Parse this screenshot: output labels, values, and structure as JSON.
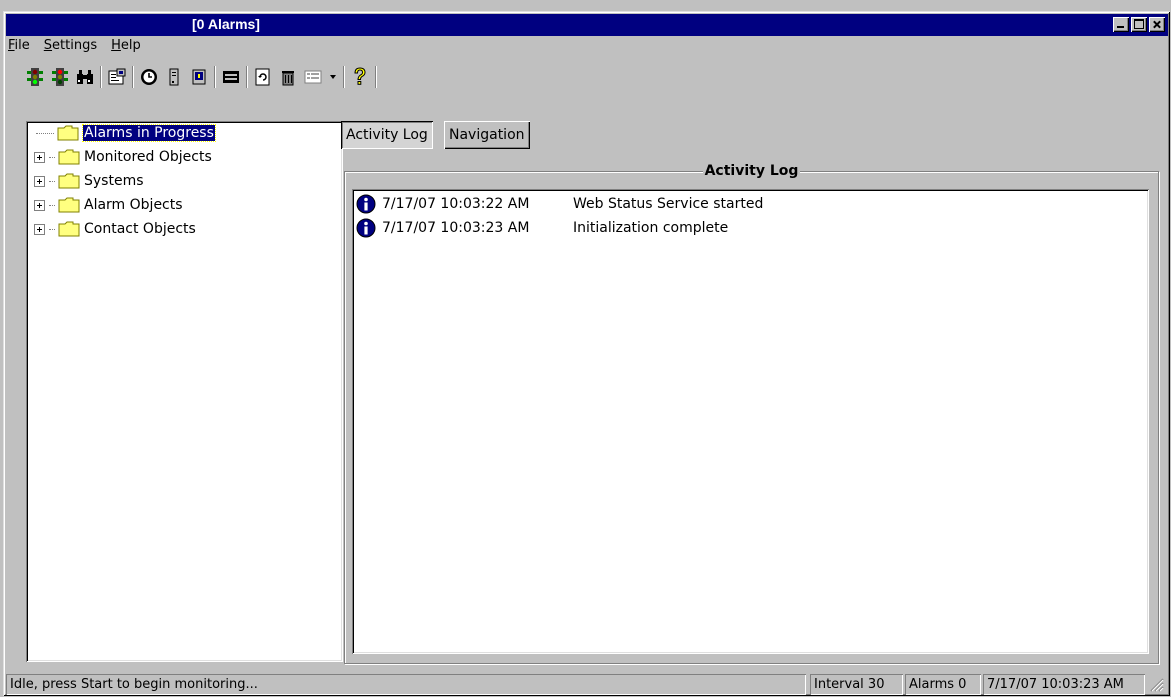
{
  "window": {
    "title": "[0 Alarms]"
  },
  "menu": [
    {
      "label": "File",
      "mnemonic": "F",
      "rest": "ile"
    },
    {
      "label": "Settings",
      "mnemonic": "S",
      "rest": "ettings"
    },
    {
      "label": "Help",
      "mnemonic": "H",
      "rest": "elp"
    }
  ],
  "toolbar": {
    "icons": [
      "traffic-light-start-icon",
      "traffic-light-stop-icon",
      "binoculars-icon",
      "properties-icon",
      "clock-icon",
      "server-icon",
      "monitor-icon",
      "display-icon",
      "refresh-icon",
      "trash-icon",
      "view-icon",
      "dropdown-arrow-icon",
      "help-icon"
    ]
  },
  "tree": {
    "items": [
      {
        "label": "Alarms in Progress",
        "selected": true
      },
      {
        "label": "Monitored Objects"
      },
      {
        "label": "Systems"
      },
      {
        "label": "Alarm Objects"
      },
      {
        "label": "Contact Objects"
      }
    ]
  },
  "tabs": [
    {
      "label": "Activity Log",
      "active": true
    },
    {
      "label": "Navigation"
    }
  ],
  "activity_log": {
    "title": "Activity Log",
    "entries": [
      {
        "icon": "info-icon",
        "time": "7/17/07 10:03:22 AM",
        "message": "Web Status Service started"
      },
      {
        "icon": "info-icon",
        "time": "7/17/07 10:03:23 AM",
        "message": "Initialization complete"
      }
    ]
  },
  "status": {
    "message": "Idle, press Start to begin monitoring...",
    "interval": "Interval 30",
    "alarms": "Alarms 0",
    "timestamp": "7/17/07 10:03:23 AM"
  },
  "colors": {
    "titlebar": "#000080",
    "face": "#c0c0c0",
    "selection": "#000080"
  }
}
